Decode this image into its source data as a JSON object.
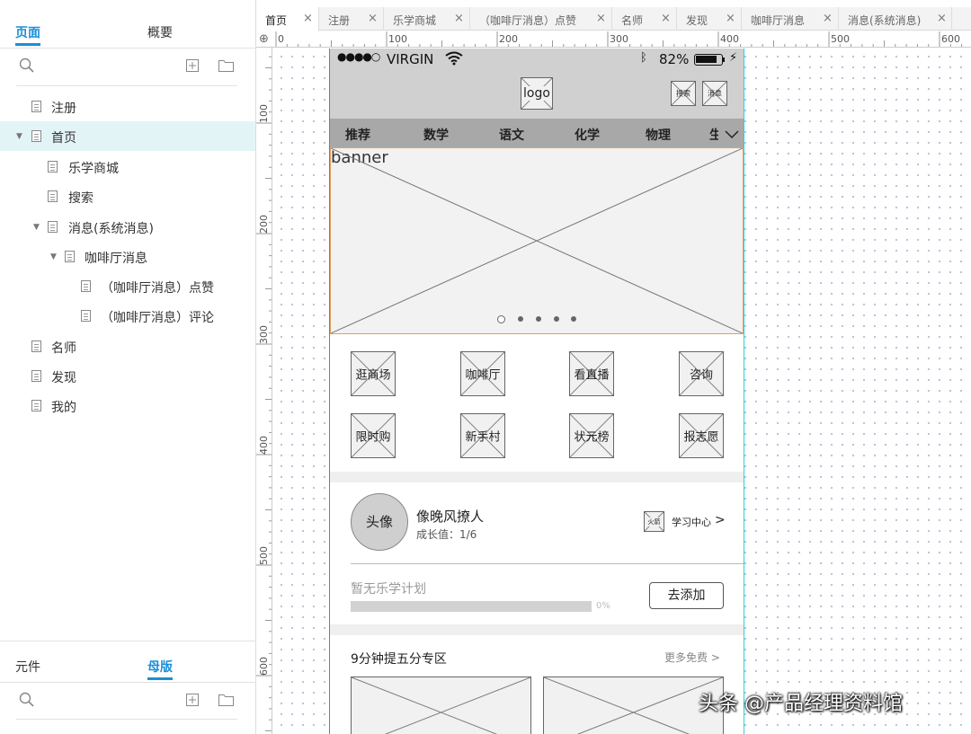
{
  "left_panel": {
    "top_tabs": [
      "页面",
      "概要"
    ],
    "tree": [
      {
        "label": "注册"
      },
      {
        "label": "首页"
      },
      {
        "label": "乐学商城"
      },
      {
        "label": "搜索"
      },
      {
        "label": "消息(系统消息)"
      },
      {
        "label": "咖啡厅消息"
      },
      {
        "label": "（咖啡厅消息）点赞"
      },
      {
        "label": "（咖啡厅消息）评论"
      },
      {
        "label": "名师"
      },
      {
        "label": "发现"
      },
      {
        "label": "我的"
      }
    ],
    "bottom_tabs": [
      "元件",
      "母版"
    ]
  },
  "editor": {
    "tabs": [
      "首页",
      "注册",
      "乐学商城",
      "（咖啡厅消息）点赞",
      "名师",
      "发现",
      "咖啡厅消息",
      "消息(系统消息)"
    ],
    "ruler_h": [
      "0",
      "100",
      "200",
      "300",
      "400",
      "500",
      "600"
    ],
    "ruler_v": [
      "100",
      "200",
      "300",
      "400",
      "500",
      "600"
    ]
  },
  "phone": {
    "status": {
      "signal": "●●●●○",
      "carrier": "VIRGIN",
      "battery": "82%"
    },
    "header": {
      "logo": "logo",
      "search": "搜索",
      "message": "消息"
    },
    "categories": [
      "推荐",
      "数学",
      "语文",
      "化学",
      "物理",
      "生"
    ],
    "banner": {
      "label": "banner"
    },
    "grid": [
      "逛商场",
      "咖啡厅",
      "看直播",
      "咨询",
      "限时购",
      "新手村",
      "状元榜",
      "报志愿"
    ],
    "profile": {
      "avatar": "头像",
      "name": "像晚风撩人",
      "growth": "成长值：1/6",
      "fire_icon": "火箭",
      "center": "学习中心",
      "arrow": ">"
    },
    "plan": {
      "empty": "暂无乐学计划",
      "percent": "0%",
      "progress": 0,
      "add_button": "去添加"
    },
    "section": {
      "title": "9分钟提五分专区",
      "more": "更多免费 >"
    }
  },
  "watermark": "头条 @产品经理资料馆"
}
